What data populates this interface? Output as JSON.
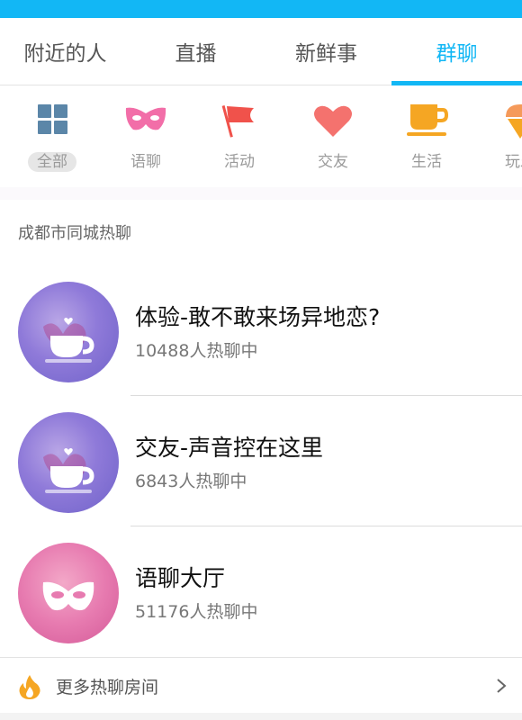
{
  "tabs": [
    {
      "label": "附近的人",
      "active": false
    },
    {
      "label": "直播",
      "active": false
    },
    {
      "label": "新鲜事",
      "active": false
    },
    {
      "label": "群聊",
      "active": true
    }
  ],
  "categories": [
    {
      "label": "全部",
      "icon": "grid-icon",
      "selected": true
    },
    {
      "label": "语聊",
      "icon": "mask-icon",
      "selected": false
    },
    {
      "label": "活动",
      "icon": "flag-icon",
      "selected": false
    },
    {
      "label": "交友",
      "icon": "heart-icon",
      "selected": false
    },
    {
      "label": "生活",
      "icon": "cup-icon",
      "selected": false
    },
    {
      "label": "玩乐",
      "icon": "ice-cream-icon",
      "selected": false
    }
  ],
  "section_title": "成都市同城热聊",
  "rooms": [
    {
      "name": "体验-敢不敢来场异地恋?",
      "count": "10488人热聊中",
      "icon": "cup-icon"
    },
    {
      "name": "交友-声音控在这里",
      "count": "6843人热聊中",
      "icon": "cup-icon"
    },
    {
      "name": "语聊大厅",
      "count": "51176人热聊中",
      "icon": "mask-icon"
    }
  ],
  "more": {
    "label": "更多热聊房间",
    "icon": "fire-icon",
    "arrow": "chevron-right-icon"
  },
  "colors": {
    "accent": "#12b7f5",
    "grid": "#5b86a8",
    "mask": "#f26ea8",
    "flag": "#f0524b",
    "heart": "#f4726e",
    "cup": "#f5a623",
    "fire": "#f5a623"
  }
}
